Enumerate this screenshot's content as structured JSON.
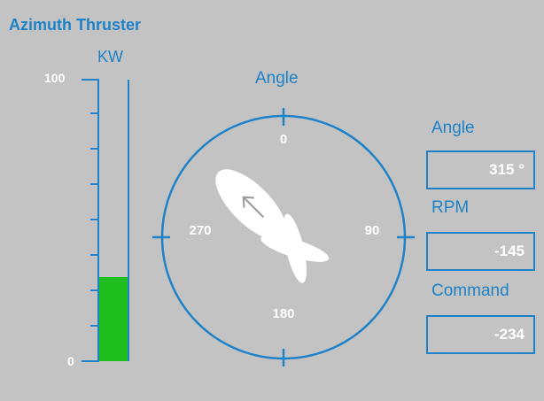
{
  "title": "Azimuth Thruster",
  "kw_gauge": {
    "label": "KW",
    "max_label": "100",
    "min_label": "0",
    "level_percent": 30,
    "fill_color": "#1fbf1f"
  },
  "angle_gauge": {
    "heading": "Angle",
    "label_0": "0",
    "label_90": "90",
    "label_180": "180",
    "label_270": "270",
    "angle_deg": 315
  },
  "readouts": {
    "angle_label": "Angle",
    "angle_value": "315 °",
    "rpm_label": "RPM",
    "rpm_value": "-145",
    "command_label": "Command",
    "command_value": "-234"
  },
  "colors": {
    "accent": "#1e82c8",
    "background": "#c3c3c3",
    "text_value": "#ffffff"
  }
}
